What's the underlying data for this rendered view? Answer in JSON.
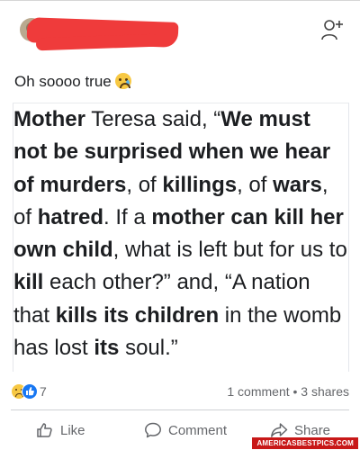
{
  "post": {
    "author_name": "",
    "caption": "Oh soooo true",
    "caption_emoji": "sad-tear-emoji"
  },
  "quote_text": "Mother Teresa said, “We must not be surprised when we hear of murders, of killings, of wars, of hatred. If a mother can kill her own child, what is left but for us to kill each other?” and, “A nation that kills its children in the womb has lost its soul.”",
  "reactions": {
    "count": "7",
    "types": [
      "sad",
      "like"
    ],
    "comments_shares": "1 comment • 3 shares"
  },
  "actions": {
    "like": "Like",
    "comment": "Comment",
    "share": "Share"
  },
  "watermark": "AMERICASBESTPICS.COM",
  "colors": {
    "like_blue": "#1877f2",
    "redaction_red": "#ef3b3b",
    "muted_text": "#65676b",
    "watermark_red": "#c81818"
  }
}
